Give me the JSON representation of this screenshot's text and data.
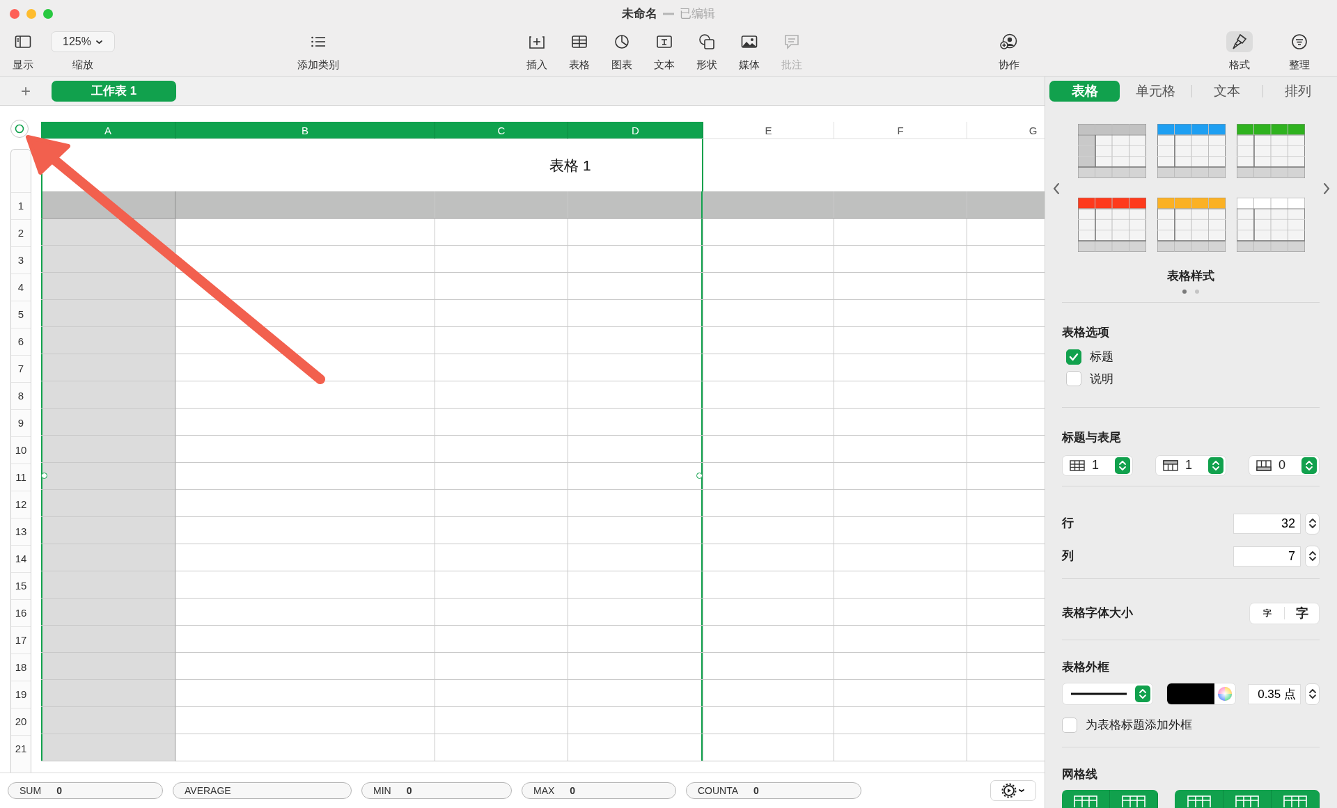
{
  "window": {
    "title": "未命名",
    "subtitle": "已编辑"
  },
  "toolbar": [
    {
      "kind": "view",
      "label": "显示",
      "disabled": false
    },
    {
      "kind": "zoom",
      "label": "缩放",
      "value": "125%",
      "disabled": false
    },
    {
      "kind": "category",
      "label": "添加类别",
      "disabled": false
    },
    {
      "kind": "insert",
      "label": "插入",
      "disabled": false
    },
    {
      "kind": "table",
      "label": "表格",
      "disabled": false
    },
    {
      "kind": "chart",
      "label": "图表",
      "disabled": false
    },
    {
      "kind": "text",
      "label": "文本",
      "disabled": false
    },
    {
      "kind": "shape",
      "label": "形状",
      "disabled": false
    },
    {
      "kind": "media",
      "label": "媒体",
      "disabled": false
    },
    {
      "kind": "comment",
      "label": "批注",
      "disabled": true
    },
    {
      "kind": "collaborate",
      "label": "协作",
      "disabled": false
    }
  ],
  "inspector_buttons": [
    {
      "kind": "format",
      "label": "格式",
      "selected": true
    },
    {
      "kind": "organize",
      "label": "整理",
      "selected": false
    }
  ],
  "sheets": {
    "add": "+",
    "tabs": [
      {
        "label": "工作表 1",
        "selected": true
      }
    ]
  },
  "inspector_tabs": [
    {
      "label": "表格",
      "selected": true
    },
    {
      "label": "单元格",
      "selected": false
    },
    {
      "label": "文本",
      "selected": false
    },
    {
      "label": "排列",
      "selected": false
    }
  ],
  "spreadsheet": {
    "title": "表格 1",
    "columns": [
      {
        "label": "A",
        "selected": true,
        "header": true
      },
      {
        "label": "B",
        "selected": true,
        "header": false
      },
      {
        "label": "C",
        "selected": true,
        "header": false
      },
      {
        "label": "D",
        "selected": true,
        "header": false
      },
      {
        "label": "E",
        "selected": false,
        "header": false
      },
      {
        "label": "F",
        "selected": false,
        "header": false
      },
      {
        "label": "G",
        "selected": false,
        "header": false
      }
    ],
    "rows": [
      {
        "number": "1",
        "header": true
      },
      {
        "number": "2",
        "header": false
      },
      {
        "number": "3",
        "header": false
      },
      {
        "number": "4",
        "header": false
      },
      {
        "number": "5",
        "header": false
      },
      {
        "number": "6",
        "header": false
      },
      {
        "number": "7",
        "header": false
      },
      {
        "number": "8",
        "header": false
      },
      {
        "number": "9",
        "header": false
      },
      {
        "number": "10",
        "header": false
      },
      {
        "number": "11",
        "header": false
      },
      {
        "number": "12",
        "header": false
      },
      {
        "number": "13",
        "header": false
      },
      {
        "number": "14",
        "header": false
      },
      {
        "number": "15",
        "header": false
      },
      {
        "number": "16",
        "header": false
      },
      {
        "number": "17",
        "header": false
      },
      {
        "number": "18",
        "header": false
      },
      {
        "number": "19",
        "header": false
      },
      {
        "number": "20",
        "header": false
      },
      {
        "number": "21",
        "header": false
      }
    ]
  },
  "inspector": {
    "styles": [
      {
        "kind": "shaded",
        "color": "#c2c2c2"
      },
      {
        "kind": "plain",
        "color": "#1e9ff2"
      },
      {
        "kind": "plain",
        "color": "#2fb21f"
      },
      {
        "kind": "plain",
        "color": "#fe3a1c"
      },
      {
        "kind": "plain",
        "color": "#fbb124"
      },
      {
        "kind": "plain",
        "color": "#ffffff"
      }
    ],
    "styles_label": "表格样式",
    "pages": [
      {
        "selected": true
      },
      {
        "selected": false
      }
    ],
    "options": {
      "title": "表格选项",
      "checks": [
        {
          "label": "标题",
          "checked": true
        },
        {
          "label": "说明",
          "checked": false
        }
      ]
    },
    "headers": {
      "title": "标题与表尾",
      "steppers": [
        {
          "kind": "header_rows",
          "value": "1"
        },
        {
          "kind": "header_columns",
          "value": "1"
        },
        {
          "kind": "footer_rows",
          "value": "0"
        }
      ]
    },
    "size": [
      {
        "label": "行",
        "value": "32"
      },
      {
        "label": "列",
        "value": "7"
      }
    ],
    "font_size": {
      "label": "表格字体大小",
      "buttons": [
        "字",
        "字"
      ]
    },
    "outline": {
      "title": "表格外框",
      "color": "#000000",
      "width": "0.35 点",
      "checkbox": {
        "label": "为表格标题添加外框",
        "checked": false
      }
    },
    "gridlines": {
      "title": "网格线"
    }
  },
  "status_bar": [
    {
      "label": "SUM",
      "value": "0"
    },
    {
      "label": "AVERAGE"
    },
    {
      "label": "MIN",
      "value": "0"
    },
    {
      "label": "MAX",
      "value": "0"
    },
    {
      "label": "COUNTA",
      "value": "0"
    }
  ]
}
